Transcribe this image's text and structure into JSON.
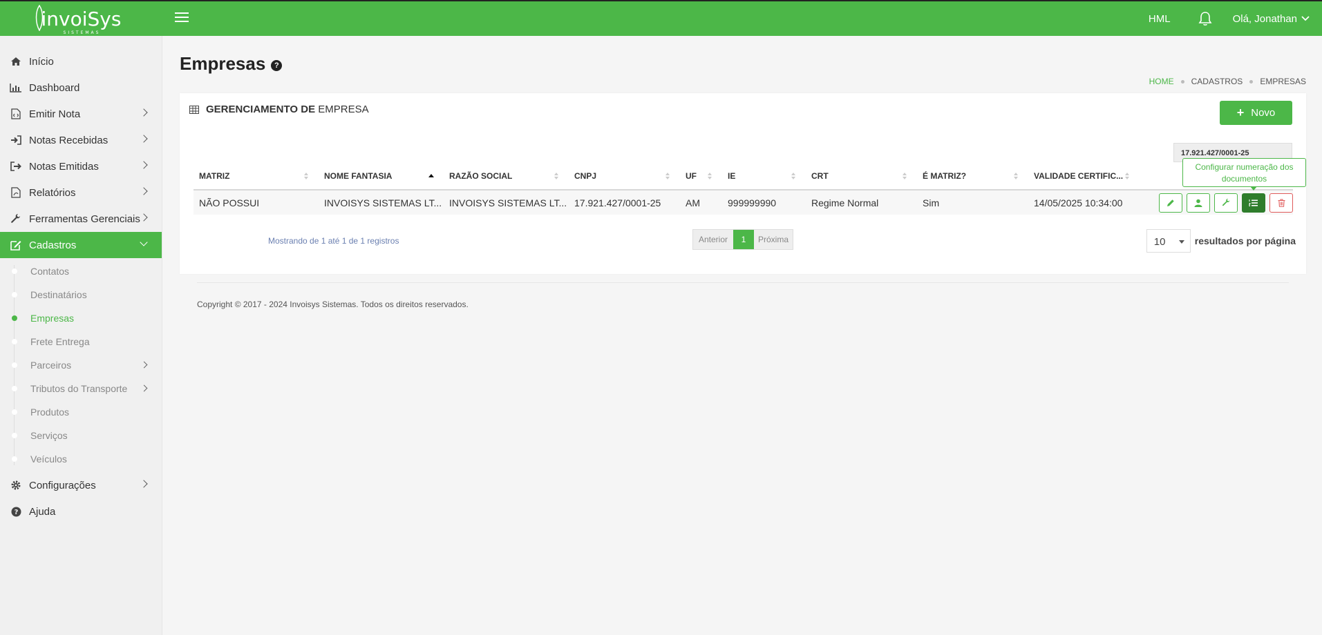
{
  "header": {
    "logo_text": "invoiSys",
    "logo_sub": "SISTEMAS",
    "environment": "HML",
    "greeting": "Olá, Jonathan"
  },
  "sidebar": {
    "items": [
      {
        "label": "Início",
        "icon": "home-icon"
      },
      {
        "label": "Dashboard",
        "icon": "bar-chart-icon"
      },
      {
        "label": "Emitir Nota",
        "icon": "file-code-icon"
      },
      {
        "label": "Notas Recebidas",
        "icon": "sign-in-icon"
      },
      {
        "label": "Notas Emitidas",
        "icon": "sign-out-icon"
      },
      {
        "label": "Relatórios",
        "icon": "pdf-file-icon"
      },
      {
        "label": "Ferramentas Gerenciais",
        "icon": "wrench-icon"
      },
      {
        "label": "Cadastros",
        "icon": "edit-icon"
      },
      {
        "label": "Configurações",
        "icon": "gear-icon"
      },
      {
        "label": "Ajuda",
        "icon": "question-circle-icon"
      }
    ],
    "cadastros_sub": [
      "Contatos",
      "Destinatários",
      "Empresas",
      "Frete Entrega",
      "Parceiros",
      "Tributos do Transporte",
      "Produtos",
      "Serviços",
      "Veículos"
    ]
  },
  "page": {
    "title": "Empresas",
    "breadcrumb": [
      "HOME",
      "CADASTROS",
      "EMPRESAS"
    ]
  },
  "panel": {
    "title_bold": "GERENCIAMENTO DE",
    "title_rest": "EMPRESA",
    "new_button": "Novo",
    "filter_value": "17.921.427/0001-25",
    "tooltip": "Configurar numeração dos documentos"
  },
  "table": {
    "headers": [
      "MATRIZ",
      "NOME FANTASIA",
      "RAZÃO SOCIAL",
      "CNPJ",
      "UF",
      "IE",
      "CRT",
      "É MATRIZ?",
      "VALIDADE CERTIFIC..."
    ],
    "rows": [
      [
        "NÃO POSSUI",
        "INVOISYS SISTEMAS LT...",
        "INVOISYS SISTEMAS LT...",
        "17.921.427/0001-25",
        "AM",
        "999999990",
        "Regime Normal",
        "Sim",
        "14/05/2025 10:34:00"
      ]
    ]
  },
  "pagination": {
    "showing": "Mostrando de 1 até 1 de 1 registros",
    "prev": "Anterior",
    "current": "1",
    "next": "Próxima",
    "per_page": "10",
    "per_page_label": "resultados por página"
  },
  "footer": {
    "copyright": "Copyright © 2017 - 2024 Invoisys Sistemas. Todos os direitos reservados."
  },
  "colors": {
    "brand_green": "#4cb748",
    "dark_green": "#2f7d2c",
    "danger_red": "#e05a5a"
  }
}
